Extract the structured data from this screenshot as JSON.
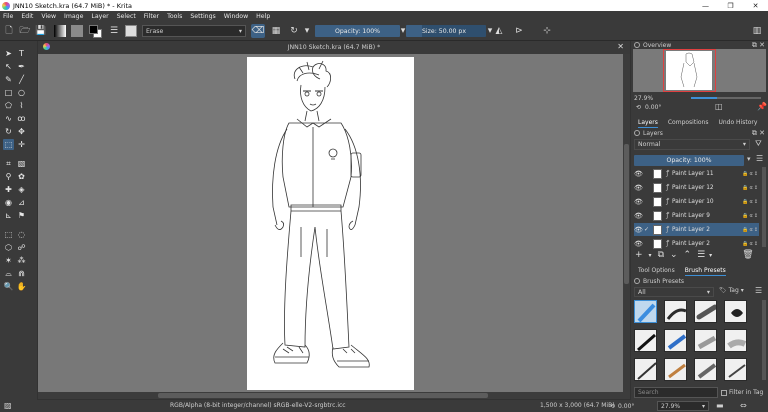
{
  "window": {
    "title": "JNN10 Sketch.kra (64.7 MiB) * - Krita",
    "minimize": "—",
    "restore": "❐",
    "close": "✕"
  },
  "menu": [
    "File",
    "Edit",
    "View",
    "Image",
    "Layer",
    "Select",
    "Filter",
    "Tools",
    "Settings",
    "Window",
    "Help"
  ],
  "toolbar": {
    "blend_mode": "Erase",
    "opacity": "Opacity: 100%",
    "size": "Size: 50.00 px"
  },
  "toolbox": {
    "tools": [
      {
        "name": "select-shapes-tool-icon",
        "g": "➤"
      },
      {
        "name": "text-tool-icon",
        "g": "T"
      },
      {
        "name": "edit-shapes-tool-icon",
        "g": "↖"
      },
      {
        "name": "calligraphy-tool-icon",
        "g": "✒"
      },
      {
        "name": "brush-tool-icon",
        "g": "✎"
      },
      {
        "name": "line-tool-icon",
        "g": "╱"
      },
      {
        "name": "rectangle-tool-icon",
        "g": "□"
      },
      {
        "name": "ellipse-tool-icon",
        "g": "○"
      },
      {
        "name": "polygon-tool-icon",
        "g": "⬠"
      },
      {
        "name": "polyline-tool-icon",
        "g": "⌇"
      },
      {
        "name": "bezier-curve-tool-icon",
        "g": "∿"
      },
      {
        "name": "freehand-path-tool-icon",
        "g": "ꝏ"
      },
      {
        "name": "dynamic-brush-tool-icon",
        "g": "↻"
      },
      {
        "name": "multibrush-tool-icon",
        "g": "✥"
      },
      {
        "name": "transform-tool-icon",
        "g": "⬚"
      },
      {
        "name": "move-tool-icon",
        "g": "✛"
      },
      {
        "name": "crop-tool-icon",
        "g": "⌗"
      },
      {
        "name": "gradient-tool-icon",
        "g": "▧"
      },
      {
        "name": "color-picker-tool-icon",
        "g": "⚲"
      },
      {
        "name": "colorize-mask-tool-icon",
        "g": "✿"
      },
      {
        "name": "smart-patch-tool-icon",
        "g": "✚"
      },
      {
        "name": "fill-tool-icon",
        "g": "◈"
      },
      {
        "name": "enclose-fill-tool-icon",
        "g": "◉"
      },
      {
        "name": "assistant-tool-icon",
        "g": "⊿"
      },
      {
        "name": "measure-tool-icon",
        "g": "⊾"
      },
      {
        "name": "reference-tool-icon",
        "g": "⚑"
      },
      {
        "name": "rectangular-select-tool-icon",
        "g": "⬚"
      },
      {
        "name": "elliptical-select-tool-icon",
        "g": "◌"
      },
      {
        "name": "polygonal-select-tool-icon",
        "g": "⬡"
      },
      {
        "name": "freehand-select-tool-icon",
        "g": "☍"
      },
      {
        "name": "contiguous-select-tool-icon",
        "g": "✶"
      },
      {
        "name": "similar-color-select-tool-icon",
        "g": "⁂"
      },
      {
        "name": "bezier-select-tool-icon",
        "g": "⌓"
      },
      {
        "name": "magnetic-select-tool-icon",
        "g": "⋒"
      },
      {
        "name": "zoom-tool-icon",
        "g": "🔍"
      },
      {
        "name": "pan-tool-icon",
        "g": "✋"
      }
    ]
  },
  "document": {
    "tab_title": "JNN10 Sketch.kra (64.7 MiB) *"
  },
  "overview": {
    "title": "Overview",
    "zoom": "27.9%",
    "rotation": "0.00°"
  },
  "docker_tabs": [
    "Layers",
    "Compositions",
    "Undo History"
  ],
  "layers": {
    "title": "Layers",
    "blend_mode": "Normal",
    "opacity": "Opacity: 100%",
    "items": [
      {
        "name": "Paint Layer 11",
        "active": false,
        "checked": false
      },
      {
        "name": "Paint Layer 12",
        "active": false,
        "checked": false
      },
      {
        "name": "Paint Layer 10",
        "active": false,
        "checked": false
      },
      {
        "name": "Paint Layer 9",
        "active": false,
        "checked": false
      },
      {
        "name": "Paint Layer 2",
        "active": true,
        "checked": true
      },
      {
        "name": "Paint Layer 2",
        "active": false,
        "checked": false
      }
    ]
  },
  "bottom_tabs": [
    "Tool Options",
    "Brush Presets"
  ],
  "brush_presets": {
    "title": "Brush Presets",
    "filter": "All",
    "tag": "Tag",
    "search_placeholder": "Search",
    "filter_in_tag": "Filter in Tag"
  },
  "status": {
    "color_space": "RGB/Alpha (8-bit integer/channel)  sRGB-elle-V2-srgbtrc.icc",
    "image_size": "1,500 x 3,000 (64.7 MiB)",
    "rotation": "0.00°",
    "zoom": "27.9%"
  }
}
